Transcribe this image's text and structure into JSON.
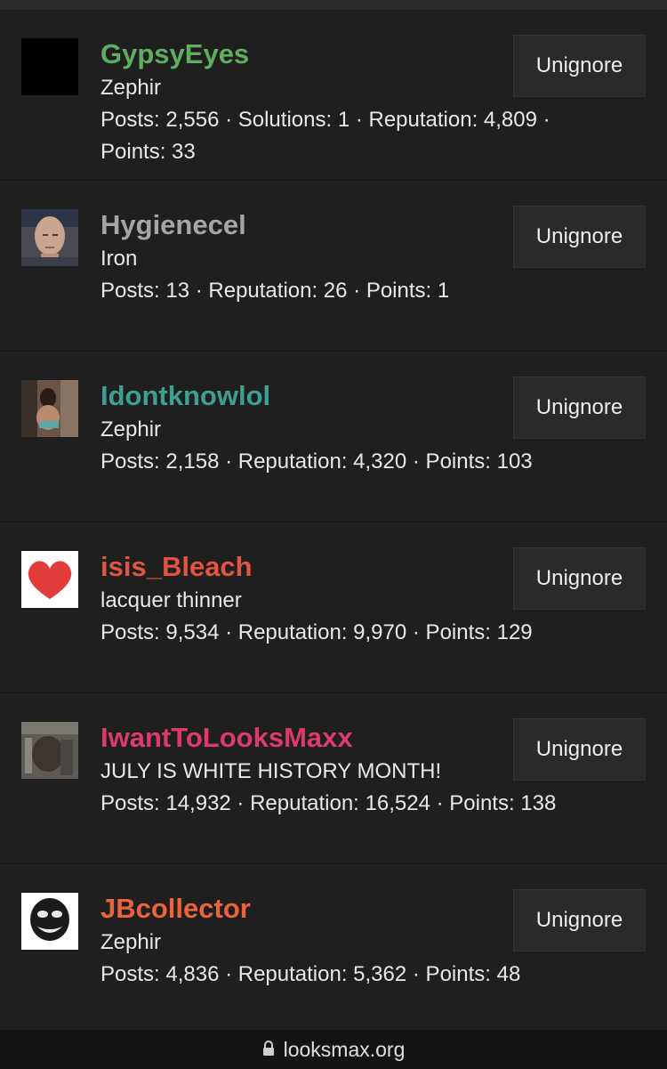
{
  "colors": {
    "background": "#1f1f1f",
    "button_bg": "#2a2a2a",
    "name_green": "#5fae5f",
    "name_gray": "#a5a5a5",
    "name_teal": "#3d9f8f",
    "name_red": "#e2543f",
    "name_pink": "#dd3a6a",
    "name_orange": "#e9643a"
  },
  "users": [
    {
      "name": "GypsyEyes",
      "title": "Zephir",
      "stats": "Posts: 2,556 · Solutions: 1 · Reputation: 4,809 · Points: 33",
      "button": "Unignore",
      "avatar": "black-square-avatar"
    },
    {
      "name": "Hygienecel",
      "title": "Iron",
      "stats": "Posts: 13 · Reputation: 26 · Points: 1",
      "button": "Unignore",
      "avatar": "man-face-avatar"
    },
    {
      "name": "Idontknowlol",
      "title": "Zephir",
      "stats": "Posts: 2,158 · Reputation: 4,320 · Points: 103",
      "button": "Unignore",
      "avatar": "woman-photo-avatar"
    },
    {
      "name": "isis_Bleach",
      "title": "lacquer thinner",
      "stats": "Posts: 9,534 · Reputation: 9,970 · Points: 129",
      "button": "Unignore",
      "avatar": "red-heart-avatar"
    },
    {
      "name": "IwantToLooksMaxx",
      "title": "JULY IS WHITE HISTORY MONTH!",
      "stats": "Posts: 14,932 · Reputation: 16,524 · Points: 138",
      "button": "Unignore",
      "avatar": "gym-photo-avatar"
    },
    {
      "name": "JBcollector",
      "title": "Zephir",
      "stats": "Posts: 4,836 · Reputation: 5,362 · Points: 48",
      "button": "Unignore",
      "avatar": "troll-face-avatar"
    }
  ],
  "footer": {
    "domain": "looksmax.org",
    "icon": "lock-icon"
  }
}
